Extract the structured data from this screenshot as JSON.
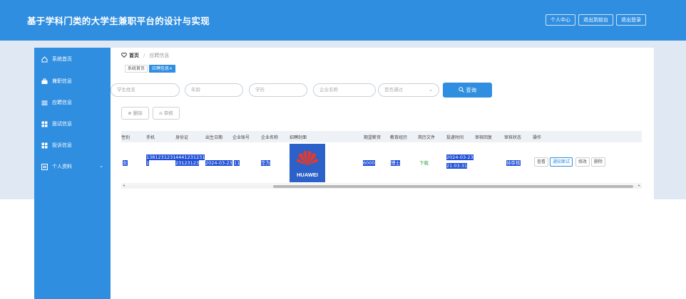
{
  "app": {
    "title": "基于学科门类的大学生兼职平台的设计与实现"
  },
  "top_actions": [
    "个人中心",
    "退出到前台",
    "退出登录"
  ],
  "sidebar": {
    "items": [
      {
        "label": "系统首页",
        "icon": "home-icon"
      },
      {
        "label": "兼职信息",
        "icon": "briefcase-icon"
      },
      {
        "label": "应聘信息",
        "icon": "list-icon"
      },
      {
        "label": "面试信息",
        "icon": "grid-icon"
      },
      {
        "label": "投诉信息",
        "icon": "grid-icon"
      },
      {
        "label": "个人资料",
        "icon": "profile-icon",
        "expand": "⌄"
      }
    ]
  },
  "breadcrumb": {
    "home": "首页",
    "separator": "/",
    "current": "应聘信息"
  },
  "tabs": [
    {
      "label": "系统首页"
    },
    {
      "label": "应聘信息",
      "close": "×"
    }
  ],
  "search": {
    "student_name_placeholder": "学生姓名",
    "age_placeholder": "年龄",
    "education_placeholder": "学历",
    "company_name_placeholder": "企业名称",
    "approved_placeholder": "是否通过",
    "query_label": "查询",
    "query_icon": "search-icon"
  },
  "actions": {
    "delete_label": "删除",
    "review_label": "审核"
  },
  "table": {
    "headers": [
      "性别",
      "手机",
      "身份证",
      "出生日期",
      "企业账号",
      "企业名称",
      "招聘封面",
      "期望薪资",
      "教育经历",
      "简历文件",
      "投递时间",
      "审核回复",
      "审核状态",
      "操作"
    ],
    "row": {
      "gender": "女",
      "phone_line1": "1381231231",
      "phone_line2": "1",
      "id_line1": "4441231231",
      "id_line2": "23123123",
      "birth": "2024-03-23",
      "company_account": "11",
      "company_name": "华为",
      "cover_text": "HUAWEI",
      "salary": "6000",
      "education": "博士",
      "resume": "下载",
      "submit_time_line1": "2024-03-23",
      "submit_time_line2": "21:03:31",
      "reply": "",
      "status": "待审核",
      "ops": [
        "查看",
        "通知面试",
        "修改",
        "删除"
      ]
    }
  },
  "colors": {
    "primary": "#2f8ee0",
    "band": "#dfe8f3",
    "selection": "#1f4fd6",
    "download": "#3aa64a"
  }
}
